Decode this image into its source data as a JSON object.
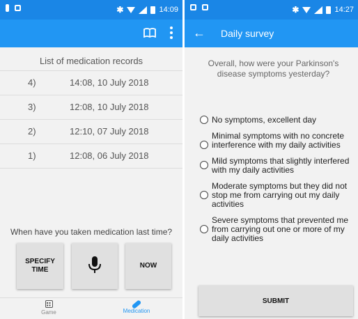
{
  "left": {
    "status": {
      "time": "14:09"
    },
    "records_title": "List of medication records",
    "records": [
      {
        "num": "4)",
        "time": "14:08, 10 July 2018"
      },
      {
        "num": "3)",
        "time": "12:08, 10 July 2018"
      },
      {
        "num": "2)",
        "time": "12:10, 07 July 2018"
      },
      {
        "num": "1)",
        "time": "12:08, 06 July 2018"
      }
    ],
    "question": "When have you taken medication last time?",
    "buttons": {
      "specify": "SPECIFY TIME",
      "now": "NOW"
    },
    "nav": {
      "game": "Game",
      "medication": "Medication"
    }
  },
  "right": {
    "status": {
      "time": "14:27"
    },
    "title": "Daily survey",
    "question": "Overall, how were your Parkinson's disease symptoms yesterday?",
    "options": [
      "No symptoms, excellent day",
      "Minimal symptoms with no concrete interference with my daily activities",
      "Mild symptoms that slightly interfered with my daily activities",
      "Moderate symptoms but they did not stop me from carrying out my daily activities",
      "Severe symptoms that prevented me from carrying out one or more of my daily activities"
    ],
    "submit": "SUBMIT"
  },
  "colors": {
    "primary": "#2196f3",
    "statusbar": "#1a86e6"
  },
  "icons": [
    "bluetooth-icon",
    "wifi-icon",
    "signal-icon",
    "battery-icon",
    "book-icon",
    "more-vert-icon",
    "microphone-icon",
    "dice-icon",
    "pill-icon",
    "back-arrow-icon"
  ]
}
